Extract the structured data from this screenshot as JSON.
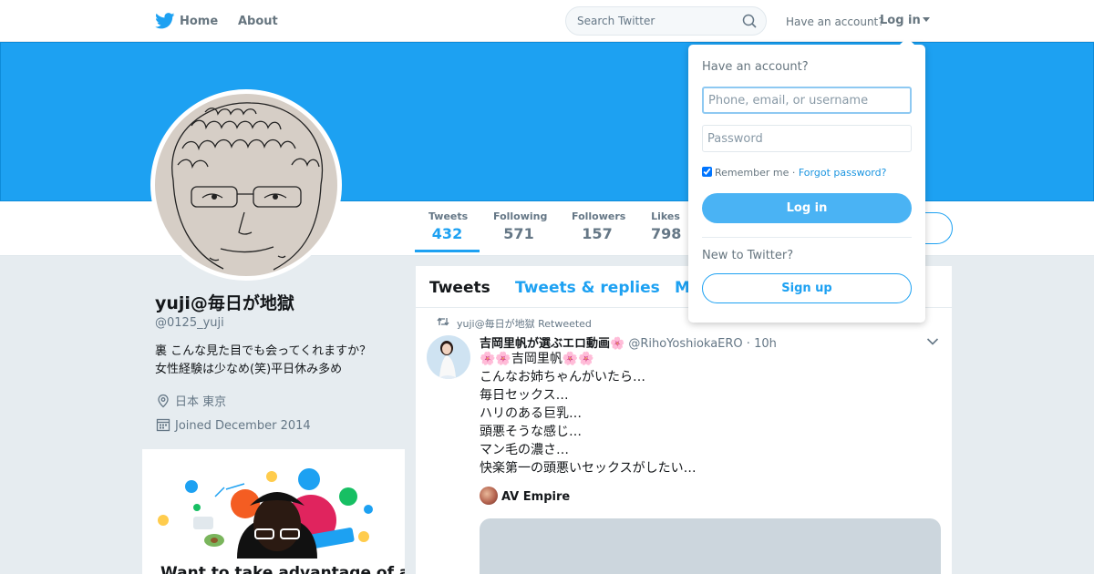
{
  "nav": {
    "home_label": "Home",
    "about_label": "About",
    "search_placeholder": "Search Twitter",
    "have_account": "Have an account?",
    "login_label": "Log in",
    "brand_color": "#1da1f2"
  },
  "profile": {
    "display_name": "yuji@毎日が地獄",
    "screen_name": "@0125_yuji",
    "bio_lines": [
      "裏 こんな見た目でも会ってくれますか？",
      "女性経験は少なめ(笑)平日休み多め"
    ],
    "location": "日本 東京",
    "joined": "Joined December 2014"
  },
  "stats": [
    {
      "label": "Tweets",
      "value": "432"
    },
    {
      "label": "Following",
      "value": "571"
    },
    {
      "label": "Followers",
      "value": "157"
    },
    {
      "label": "Likes",
      "value": "798"
    }
  ],
  "timeline": {
    "tabs": [
      "Tweets",
      "Tweets & replies",
      "M"
    ],
    "tweet": {
      "retweet_context": "yuji@毎日が地獄 Retweeted",
      "fullname": "吉岡里帆が選ぶエロ動画🌸",
      "handle": "@RihoYoshiokaERO",
      "time": "10h",
      "lines": [
        "🌸🌸吉岡里帆🌸🌸",
        "こんなお姉ちゃんがいたら…",
        "毎日セックス…",
        "ハリのある巨乳…",
        "頭悪そうな感じ…",
        "マン毛の濃さ…",
        "快楽第一の頭悪いセックスがしたい…"
      ],
      "card_source": "AV Empire"
    }
  },
  "promo": {
    "heading": "Want to take advantage of all"
  },
  "login_dropdown": {
    "title": "Have an account?",
    "username_placeholder": "Phone, email, or username",
    "password_placeholder": "Password",
    "remember_label": "Remember me",
    "separator": " · ",
    "forgot_label": "Forgot password?",
    "login_button": "Log in",
    "new_label": "New to Twitter?",
    "signup_button": "Sign up"
  }
}
